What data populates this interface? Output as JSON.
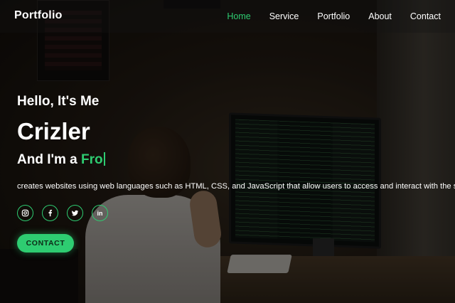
{
  "header": {
    "logo": "Portfolio",
    "nav": [
      {
        "label": "Home",
        "active": true
      },
      {
        "label": "Service",
        "active": false
      },
      {
        "label": "Portfolio",
        "active": false
      },
      {
        "label": "About",
        "active": false
      },
      {
        "label": "Contact",
        "active": false
      }
    ]
  },
  "hero": {
    "greeting": "Hello, It's Me",
    "name": "Crizler",
    "role_prefix": "And I'm a",
    "role_typed": "Fro",
    "description": "creates websites using web languages such as HTML, CSS, and JavaScript that allow users to access and interact with the site",
    "socials": [
      "instagram-icon",
      "facebook-icon",
      "twitter-icon",
      "linkedin-icon"
    ],
    "cta_label": "CONTACT"
  },
  "colors": {
    "accent": "#2ecc71",
    "text": "#ffffff"
  }
}
